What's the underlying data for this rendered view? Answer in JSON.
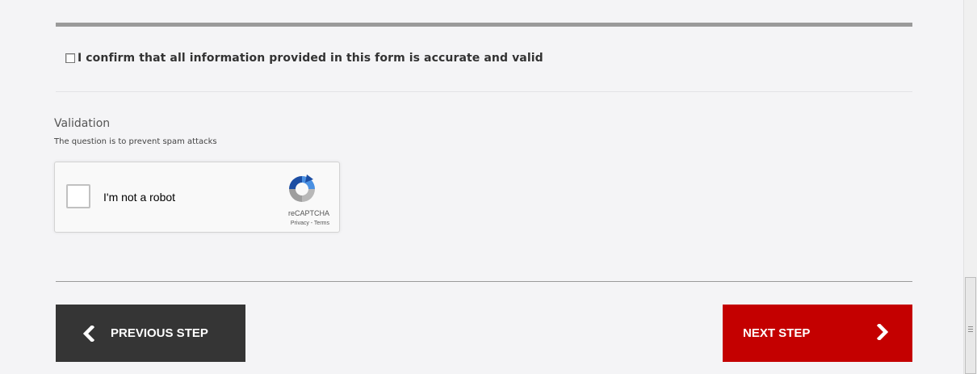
{
  "confirm": {
    "label": "I confirm that all information provided in this form is accurate and valid"
  },
  "validation": {
    "title": "Validation",
    "hint": "The question is to prevent spam attacks"
  },
  "recaptcha": {
    "label": "I'm not a robot",
    "brand": "reCAPTCHA",
    "links": "Privacy - Terms"
  },
  "nav": {
    "prev_label": "PREVIOUS STEP",
    "next_label": "NEXT STEP"
  },
  "colors": {
    "prev_button": "#353535",
    "next_button": "#c40000",
    "background": "#f4f4f6"
  },
  "icons": {
    "prev": "chevron-left-icon",
    "next": "chevron-right-icon",
    "captcha": "recaptcha-logo-icon"
  }
}
